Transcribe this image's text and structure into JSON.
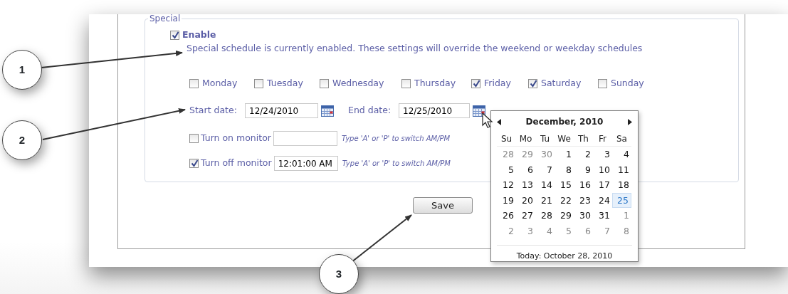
{
  "fieldset": {
    "legend": "Special"
  },
  "enable": {
    "label": "Enable",
    "checked": true
  },
  "description": "Special schedule is currently enabled. These settings will override the weekend or weekday schedules",
  "days": [
    {
      "label": "Monday",
      "checked": false
    },
    {
      "label": "Tuesday",
      "checked": false
    },
    {
      "label": "Wednesday",
      "checked": false
    },
    {
      "label": "Thursday",
      "checked": false
    },
    {
      "label": "Friday",
      "checked": true
    },
    {
      "label": "Saturday",
      "checked": true
    },
    {
      "label": "Sunday",
      "checked": false
    }
  ],
  "dates": [
    {
      "label": "Start date:",
      "value": "12/24/2010"
    },
    {
      "label": "End date:",
      "value": "12/25/2010"
    }
  ],
  "monitors": [
    {
      "label": "Turn on monitor",
      "checked": false,
      "hint": "Type 'A' or 'P' to switch AM/PM"
    },
    {
      "label": "Turn off monitor",
      "checked": true,
      "value": "12:01:00 AM",
      "hint": "Type 'A' or 'P' to switch AM/PM"
    }
  ],
  "save_button": "Save",
  "calendar": {
    "title": "December, 2010",
    "weekdays": [
      "Su",
      "Mo",
      "Tu",
      "We",
      "Th",
      "Fr",
      "Sa"
    ],
    "weeks": [
      [
        {
          "day": "28",
          "muted": true,
          "selected": false
        },
        {
          "day": "29",
          "muted": true,
          "selected": false
        },
        {
          "day": "30",
          "muted": true,
          "selected": false
        },
        {
          "day": "1",
          "muted": false,
          "selected": false
        },
        {
          "day": "2",
          "muted": false,
          "selected": false
        },
        {
          "day": "3",
          "muted": false,
          "selected": false
        },
        {
          "day": "4",
          "muted": false,
          "selected": false
        }
      ],
      [
        {
          "day": "5",
          "muted": false,
          "selected": false
        },
        {
          "day": "6",
          "muted": false,
          "selected": false
        },
        {
          "day": "7",
          "muted": false,
          "selected": false
        },
        {
          "day": "8",
          "muted": false,
          "selected": false
        },
        {
          "day": "9",
          "muted": false,
          "selected": false
        },
        {
          "day": "10",
          "muted": false,
          "selected": false
        },
        {
          "day": "11",
          "muted": false,
          "selected": false
        }
      ],
      [
        {
          "day": "12",
          "muted": false,
          "selected": false
        },
        {
          "day": "13",
          "muted": false,
          "selected": false
        },
        {
          "day": "14",
          "muted": false,
          "selected": false
        },
        {
          "day": "15",
          "muted": false,
          "selected": false
        },
        {
          "day": "16",
          "muted": false,
          "selected": false
        },
        {
          "day": "17",
          "muted": false,
          "selected": false
        },
        {
          "day": "18",
          "muted": false,
          "selected": false
        }
      ],
      [
        {
          "day": "19",
          "muted": false,
          "selected": false
        },
        {
          "day": "20",
          "muted": false,
          "selected": false
        },
        {
          "day": "21",
          "muted": false,
          "selected": false
        },
        {
          "day": "22",
          "muted": false,
          "selected": false
        },
        {
          "day": "23",
          "muted": false,
          "selected": false
        },
        {
          "day": "24",
          "muted": false,
          "selected": false
        },
        {
          "day": "25",
          "muted": false,
          "selected": true
        }
      ],
      [
        {
          "day": "26",
          "muted": false,
          "selected": false
        },
        {
          "day": "27",
          "muted": false,
          "selected": false
        },
        {
          "day": "28",
          "muted": false,
          "selected": false
        },
        {
          "day": "29",
          "muted": false,
          "selected": false
        },
        {
          "day": "30",
          "muted": false,
          "selected": false
        },
        {
          "day": "31",
          "muted": false,
          "selected": false
        },
        {
          "day": "1",
          "muted": true,
          "selected": false
        }
      ],
      [
        {
          "day": "2",
          "muted": true,
          "selected": false
        },
        {
          "day": "3",
          "muted": true,
          "selected": false
        },
        {
          "day": "4",
          "muted": true,
          "selected": false
        },
        {
          "day": "5",
          "muted": true,
          "selected": false
        },
        {
          "day": "6",
          "muted": true,
          "selected": false
        },
        {
          "day": "7",
          "muted": true,
          "selected": false
        },
        {
          "day": "8",
          "muted": true,
          "selected": false
        }
      ]
    ],
    "today": "Today: October 28, 2010"
  },
  "callouts": [
    "1",
    "2",
    "3"
  ]
}
